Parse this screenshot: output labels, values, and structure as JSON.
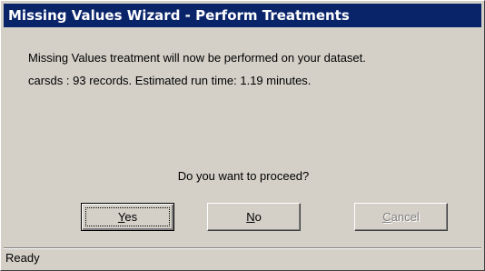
{
  "window": {
    "title": "Missing Values Wizard - Perform Treatments"
  },
  "message": {
    "line1": "Missing Values treatment will now be performed on your dataset.",
    "line2": "carsds : 93 records. Estimated run time: 1.19 minutes.",
    "question": "Do you want to proceed?"
  },
  "buttons": {
    "yes": {
      "mnemonic": "Y",
      "rest": "es"
    },
    "no": {
      "mnemonic": "N",
      "rest": "o"
    },
    "cancel": {
      "mnemonic": "C",
      "rest": "ancel",
      "disabled": true
    }
  },
  "status": {
    "text": "Ready"
  },
  "colors": {
    "titlebar": "#0a246a",
    "face": "#d4d0c8",
    "disabled_text": "#808080"
  }
}
